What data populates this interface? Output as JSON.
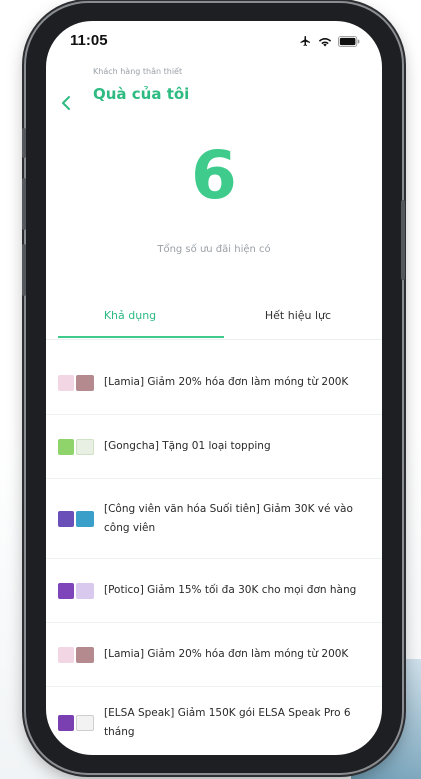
{
  "status_bar": {
    "time": "11:05",
    "icons": [
      "airplane-icon",
      "wifi-icon",
      "battery-icon"
    ]
  },
  "header": {
    "breadcrumb": "Khách hàng thân thiết",
    "title": "Quà của tôi",
    "back_icon": "chevron-left-icon"
  },
  "summary": {
    "count": "6",
    "label": "Tổng số ưu đãi hiện có"
  },
  "tabs": [
    {
      "label": "Khả dụng",
      "active": true
    },
    {
      "label": "Hết hiệu lực",
      "active": false
    }
  ],
  "rewards": [
    {
      "text": "[Lamia] Giảm 20% hóa đơn làm móng từ 200K",
      "thumb_colors": [
        "#f3d6e4",
        "#b48a8f"
      ]
    },
    {
      "text": "[Gongcha] Tặng 01 loại topping",
      "thumb_colors": [
        "#8fd46b",
        "#e8efe3"
      ]
    },
    {
      "text": "[Công viên văn hóa Suối tiên] Giảm 30K vé vào công viên",
      "thumb_colors": [
        "#6b4fb8",
        "#3aa0c9"
      ]
    },
    {
      "text": "[Potico] Giảm 15% tối đa 30K cho mọi đơn hàng",
      "thumb_colors": [
        "#7d45b9",
        "#d9c9ef"
      ]
    },
    {
      "text": "[Lamia] Giảm 20% hóa đơn làm móng từ 200K",
      "thumb_colors": [
        "#f3d6e4",
        "#b48a8f"
      ]
    },
    {
      "text": "[ELSA Speak] Giảm 150K gói ELSA Speak Pro 6 tháng",
      "thumb_colors": [
        "#7a3fb0",
        "#f2f2f2"
      ]
    }
  ],
  "colors": {
    "accent": "#3ecb8b",
    "title": "#2dbb82"
  }
}
